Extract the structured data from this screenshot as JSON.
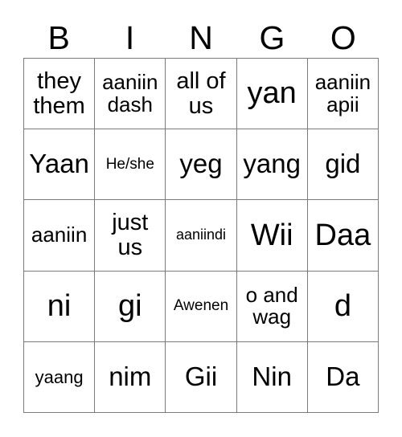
{
  "card": {
    "header": {
      "letters": [
        "B",
        "I",
        "N",
        "G",
        "O"
      ]
    },
    "colors": {
      "border": "#7a7a7a",
      "text": "#000000",
      "background": "#ffffff"
    },
    "rows": [
      [
        {
          "text": "they them",
          "size": "fs-md"
        },
        {
          "text": "aaniin dash",
          "size": "fs-sm"
        },
        {
          "text": "all of us",
          "size": "fs-md"
        },
        {
          "text": "yan",
          "size": "fs-xl"
        },
        {
          "text": "aaniin apii",
          "size": "fs-sm"
        }
      ],
      [
        {
          "text": "Yaan",
          "size": "fs-lg"
        },
        {
          "text": "He/she",
          "size": "fs-xxs"
        },
        {
          "text": "yeg",
          "size": "fs-lg"
        },
        {
          "text": "yang",
          "size": "fs-lg"
        },
        {
          "text": "gid",
          "size": "fs-lg"
        }
      ],
      [
        {
          "text": "aaniin",
          "size": "fs-sm"
        },
        {
          "text": "just us",
          "size": "fs-md"
        },
        {
          "text": "aaniindi",
          "size": "fs-tiny"
        },
        {
          "text": "Wii",
          "size": "fs-xl"
        },
        {
          "text": "Daa",
          "size": "fs-xl"
        }
      ],
      [
        {
          "text": "ni",
          "size": "fs-xl"
        },
        {
          "text": "gi",
          "size": "fs-xl"
        },
        {
          "text": "Awenen",
          "size": "fs-xxs"
        },
        {
          "text": "o and wag",
          "size": "fs-sm"
        },
        {
          "text": "d",
          "size": "fs-xl"
        }
      ],
      [
        {
          "text": "yaang",
          "size": "fs-xs"
        },
        {
          "text": "nim",
          "size": "fs-lg"
        },
        {
          "text": "Gii",
          "size": "fs-lg"
        },
        {
          "text": "Nin",
          "size": "fs-lg"
        },
        {
          "text": "Da",
          "size": "fs-lg"
        }
      ]
    ]
  }
}
